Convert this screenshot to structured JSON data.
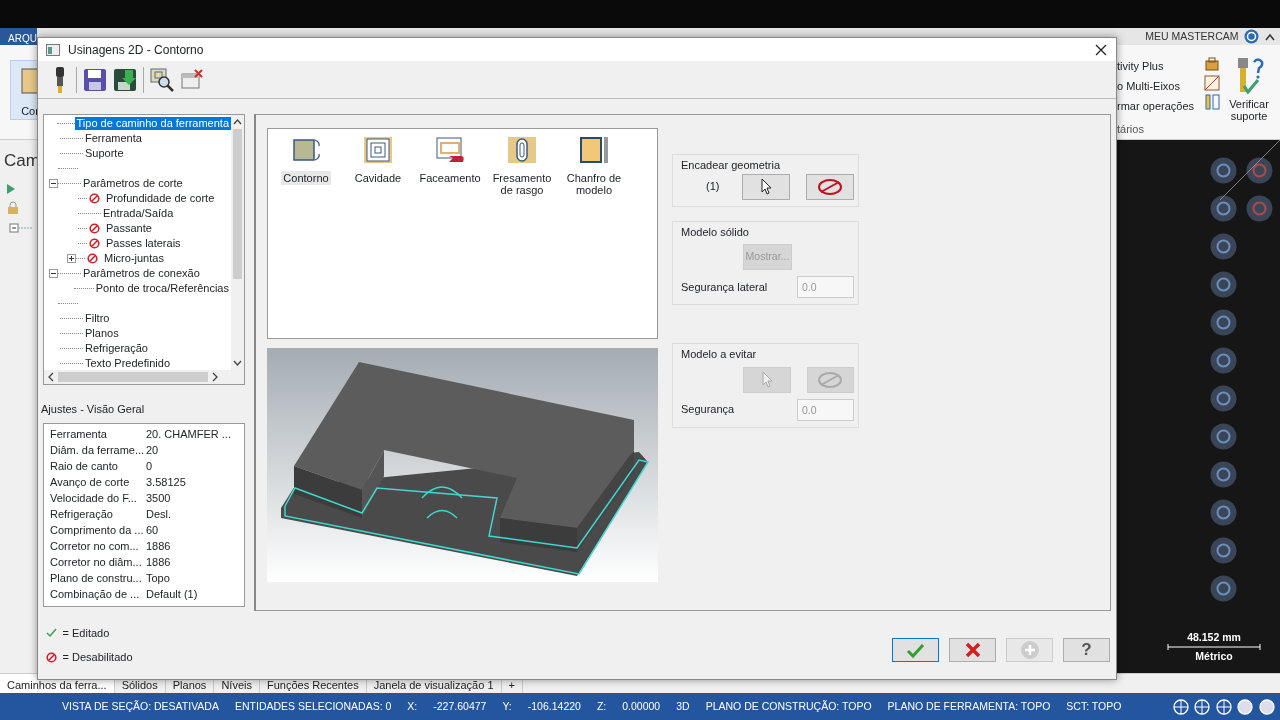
{
  "app": {
    "file_tab": "ARQU",
    "account_label": "MEU MASTERCAM",
    "ribbon_left_label": "Cor",
    "ribbon_items": [
      {
        "label": "tivity Plus"
      },
      {
        "label": "o Multi-Eixos"
      },
      {
        "label": "rmar operações"
      }
    ],
    "ribbon_group_label": "tários",
    "verify_button": "Verificar suporte",
    "side_panel_title": "Cam",
    "bottom_tabs": [
      {
        "label": "Caminhos da ferra...",
        "selected": true
      },
      {
        "label": "Sólidos",
        "selected": false
      },
      {
        "label": "Planos",
        "selected": false
      },
      {
        "label": "Níveis",
        "selected": false
      },
      {
        "label": "Funções Recentes",
        "selected": false
      },
      {
        "label": "Janela de visualização 1",
        "selected": false
      }
    ],
    "add_tab": "+",
    "scale": {
      "value": "48.152 mm",
      "unit": "Métrico"
    },
    "status_bar": [
      "VISTA DE SEÇÃO: DESATIVADA",
      "ENTIDADES SELECIONADAS: 0",
      "X:",
      "-227.60477",
      "Y:",
      "-106.14220",
      "Z:",
      "0.00000",
      "3D",
      "PLANO DE CONSTRUÇÃO: TOPO",
      "PLANO DE FERRAMENTA: TOPO",
      "SCT: TOPO"
    ]
  },
  "dialog": {
    "title": "Usinagens 2D - Contorno",
    "tree": [
      {
        "label": "Tipo de caminho da ferramenta",
        "selected": true,
        "disabled": false
      },
      {
        "label": "Ferramenta",
        "selected": false,
        "disabled": false
      },
      {
        "label": "Suporte",
        "selected": false,
        "disabled": false
      },
      {
        "kind": "blank"
      },
      {
        "label": "Parâmetros de corte",
        "selected": false,
        "disabled": false,
        "expanded": true,
        "children": [
          {
            "label": "Profundidade de corte",
            "selected": false,
            "disabled": true
          },
          {
            "label": "Entrada/Saída",
            "selected": false,
            "disabled": false
          },
          {
            "label": "Passante",
            "selected": false,
            "disabled": true
          },
          {
            "label": "Passes laterais",
            "selected": false,
            "disabled": true
          },
          {
            "label": "Micro-juntas",
            "selected": false,
            "disabled": true,
            "expanded": false
          }
        ]
      },
      {
        "label": "Parâmetros de conexão",
        "selected": false,
        "disabled": false,
        "expanded": true,
        "children": [
          {
            "label": "Ponto de troca/Referências",
            "selected": false,
            "disabled": false
          }
        ]
      },
      {
        "kind": "blank"
      },
      {
        "label": "Filtro",
        "selected": false,
        "disabled": false
      },
      {
        "label": "Planos",
        "selected": false,
        "disabled": false
      },
      {
        "label": "Refrigeração",
        "selected": false,
        "disabled": false
      },
      {
        "label": "Texto Predefinido",
        "selected": false,
        "disabled": false
      }
    ],
    "overview_title": "Ajustes - Visão Geral",
    "overview": [
      {
        "label": "Ferramenta",
        "value": "20. CHAMFER ..."
      },
      {
        "label": "Diâm. da ferrame...",
        "value": "20"
      },
      {
        "label": "Raio de canto",
        "value": "0"
      },
      {
        "label": "Avanço de corte",
        "value": "3.58125"
      },
      {
        "label": "Velocidade do F...",
        "value": "3500"
      },
      {
        "label": "Refrigeração",
        "value": "Desl."
      },
      {
        "label": "Comprimento da ...",
        "value": "60"
      },
      {
        "label": "Corretor no com...",
        "value": "1886"
      },
      {
        "label": "Corretor no diâm...",
        "value": "1886"
      },
      {
        "label": "Plano de constru...",
        "value": "Topo"
      },
      {
        "label": "Combinação de ...",
        "value": "Default (1)"
      }
    ],
    "legend": [
      {
        "kind": "edited",
        "label": "= Editado"
      },
      {
        "kind": "disabled",
        "label": "= Desabilitado"
      }
    ],
    "toolpath_types": [
      {
        "kind": "contour",
        "label": "Contorno",
        "selected": true
      },
      {
        "kind": "pocket",
        "label": "Cavidade",
        "selected": false
      },
      {
        "kind": "facing",
        "label": "Faceamento",
        "selected": false
      },
      {
        "kind": "slot",
        "label": "Fresamento de rasgo",
        "selected": false
      },
      {
        "kind": "chamfer",
        "label": "Chanfro de modelo",
        "selected": false
      }
    ],
    "chain": {
      "title": "Encadear geometria",
      "count": "(1)",
      "disabled": false
    },
    "solid_model": {
      "title": "Modelo sólido",
      "button": "Mostrar...",
      "disabled": true,
      "clearance_label": "Segurança lateral",
      "clearance": "0.0"
    },
    "avoid_model": {
      "title": "Modelo a evitar",
      "disabled": true,
      "clearance_label": "Segurança",
      "clearance": "0.0"
    },
    "footer_buttons": [
      {
        "kind": "ok",
        "disabled": false
      },
      {
        "kind": "cancel",
        "disabled": false
      },
      {
        "kind": "add",
        "disabled": true
      },
      {
        "kind": "help",
        "label": "?",
        "disabled": false
      }
    ]
  }
}
